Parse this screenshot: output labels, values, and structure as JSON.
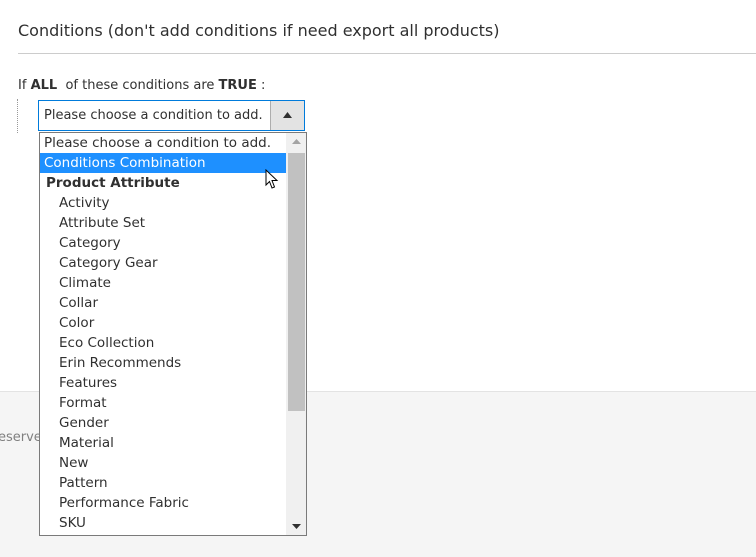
{
  "section": {
    "title": "Conditions (don't add conditions if need export all products)"
  },
  "rule": {
    "prefix": "If",
    "aggregator": "ALL",
    "middle": "of these conditions are",
    "value": "TRUE",
    "suffix": ":"
  },
  "select": {
    "value": "Please choose a condition to add."
  },
  "dropdown": {
    "options": [
      {
        "label": "Please choose a condition to add.",
        "kind": "placeholder"
      },
      {
        "label": "Conditions Combination",
        "kind": "option",
        "selected": true
      },
      {
        "label": "Product Attribute",
        "kind": "group"
      },
      {
        "label": "Activity",
        "kind": "sub"
      },
      {
        "label": "Attribute Set",
        "kind": "sub"
      },
      {
        "label": "Category",
        "kind": "sub"
      },
      {
        "label": "Category Gear",
        "kind": "sub"
      },
      {
        "label": "Climate",
        "kind": "sub"
      },
      {
        "label": "Collar",
        "kind": "sub"
      },
      {
        "label": "Color",
        "kind": "sub"
      },
      {
        "label": "Eco Collection",
        "kind": "sub"
      },
      {
        "label": "Erin Recommends",
        "kind": "sub"
      },
      {
        "label": "Features",
        "kind": "sub"
      },
      {
        "label": "Format",
        "kind": "sub"
      },
      {
        "label": "Gender",
        "kind": "sub"
      },
      {
        "label": "Material",
        "kind": "sub"
      },
      {
        "label": "New",
        "kind": "sub"
      },
      {
        "label": "Pattern",
        "kind": "sub"
      },
      {
        "label": "Performance Fabric",
        "kind": "sub"
      },
      {
        "label": "SKU",
        "kind": "sub"
      }
    ]
  },
  "footer": {
    "text_fragment": "eserve"
  },
  "colors": {
    "accent": "#007bdb",
    "selected_bg": "#1e90ff"
  }
}
